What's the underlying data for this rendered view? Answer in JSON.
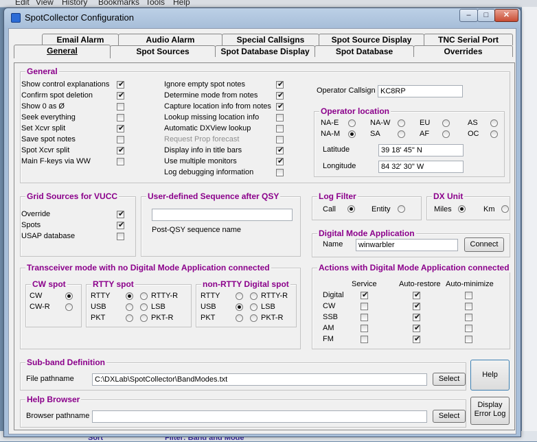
{
  "background": {
    "menu": [
      "Edit",
      "View",
      "History",
      "Bookmarks",
      "Tools",
      "Help"
    ],
    "bottom": {
      "sort": "Sort",
      "filter": "Filter: Band and Mode"
    }
  },
  "window": {
    "title": "SpotCollector Configuration",
    "controls": {
      "minimize": "–",
      "maximize": "□",
      "close": "✕"
    }
  },
  "tabs": {
    "row1": [
      "Email Alarm",
      "Audio Alarm",
      "Special Callsigns",
      "Spot Source Display",
      "TNC Serial Port"
    ],
    "row2": [
      "General",
      "Spot Sources",
      "Spot Database Display",
      "Spot Database",
      "Overrides"
    ],
    "active": "General"
  },
  "general": {
    "title": "General",
    "col1": [
      {
        "label": "Show control explanations",
        "checked": true
      },
      {
        "label": "Confirm spot deletion",
        "checked": true
      },
      {
        "label": "Show 0 as Ø",
        "checked": false
      },
      {
        "label": "Seek everything",
        "checked": false
      },
      {
        "label": "Set Xcvr split",
        "checked": true
      },
      {
        "label": "Save spot notes",
        "checked": false
      },
      {
        "label": "Spot Xcvr split",
        "checked": true
      },
      {
        "label": "Main F-keys via WW",
        "checked": false
      }
    ],
    "col2": [
      {
        "label": "Ignore empty spot notes",
        "checked": true
      },
      {
        "label": "Determine mode from notes",
        "checked": true
      },
      {
        "label": "Capture location info from notes",
        "checked": true
      },
      {
        "label": "Lookup missing location info",
        "checked": false
      },
      {
        "label": "Automatic DXView lookup",
        "checked": false
      },
      {
        "label": "Request Prop forecast",
        "checked": false,
        "disabled": true
      },
      {
        "label": "Display info in title bars",
        "checked": true
      },
      {
        "label": "Use multiple monitors",
        "checked": true
      },
      {
        "label": "Log debugging information",
        "checked": false
      }
    ]
  },
  "operator": {
    "callsign_label": "Operator Callsign",
    "callsign": "KC8RP",
    "location_title": "Operator location",
    "regions": [
      "NA-E",
      "NA-W",
      "EU",
      "AS",
      "NA-M",
      "SA",
      "AF",
      "OC"
    ],
    "selected_region": "NA-M",
    "latitude_label": "Latitude",
    "latitude": "39 18' 45\" N",
    "longitude_label": "Longitude",
    "longitude": "84 32' 30\" W"
  },
  "grid_sources": {
    "title": "Grid Sources for VUCC",
    "items": [
      {
        "label": "Override",
        "checked": true
      },
      {
        "label": "Spots",
        "checked": true
      },
      {
        "label": "USAP database",
        "checked": false
      }
    ]
  },
  "user_sequence": {
    "title": "User-defined Sequence after QSY",
    "value": "",
    "caption": "Post-QSY sequence name"
  },
  "log_filter": {
    "title": "Log Filter",
    "call": "Call",
    "entity": "Entity",
    "selected": "Call"
  },
  "dx_unit": {
    "title": "DX Unit",
    "miles": "Miles",
    "km": "Km",
    "selected": "Miles"
  },
  "digital_app": {
    "title": "Digital Mode Application",
    "name_label": "Name",
    "name": "winwarbler",
    "connect": "Connect"
  },
  "transceiver": {
    "title": "Transceiver mode with no Digital Mode Application connected",
    "cw": {
      "title": "CW spot",
      "options": [
        "CW",
        "CW-R"
      ],
      "selected": "CW"
    },
    "rtty": {
      "title": "RTTY spot",
      "left": [
        "RTTY",
        "USB",
        "PKT"
      ],
      "right": [
        "RTTY-R",
        "LSB",
        "PKT-R"
      ],
      "selected": "RTTY"
    },
    "nonrtty": {
      "title": "non-RTTY Digital spot",
      "left": [
        "RTTY",
        "USB",
        "PKT"
      ],
      "right": [
        "RTTY-R",
        "LSB",
        "PKT-R"
      ],
      "selected": "USB"
    }
  },
  "actions": {
    "title": "Actions with Digital Mode Application connected",
    "headers": [
      "Service",
      "Auto-restore",
      "Auto-minimize"
    ],
    "rows": [
      {
        "mode": "Digital",
        "service": true,
        "restore": true,
        "minimize": false
      },
      {
        "mode": "CW",
        "service": false,
        "restore": true,
        "minimize": false
      },
      {
        "mode": "SSB",
        "service": false,
        "restore": true,
        "minimize": false
      },
      {
        "mode": "AM",
        "service": false,
        "restore": true,
        "minimize": false
      },
      {
        "mode": "FM",
        "service": false,
        "restore": true,
        "minimize": false
      }
    ]
  },
  "subband": {
    "title": "Sub-band Definition",
    "label": "File pathname",
    "value": "C:\\DXLab\\SpotCollector\\BandModes.txt",
    "select": "Select"
  },
  "help_browser": {
    "title": "Help Browser",
    "label": "Browser pathname",
    "value": "",
    "select": "Select"
  },
  "buttons": {
    "help": "Help",
    "display_error_log_1": "Display",
    "display_error_log_2": "Error Log"
  }
}
